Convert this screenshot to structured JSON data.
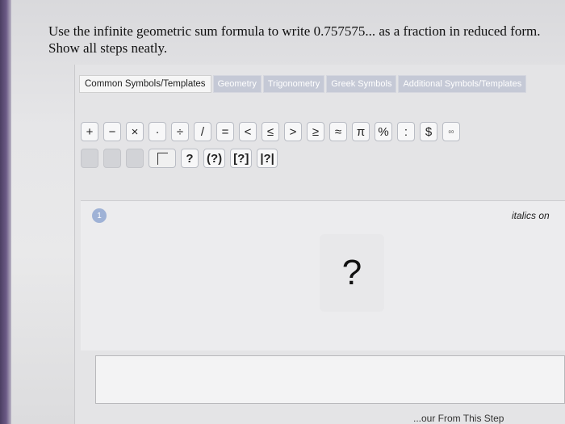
{
  "question": {
    "line1": "Use the infinite geometric sum formula to write 0.757575... as a fraction in reduced form.",
    "line2": "Show all steps neatly."
  },
  "tabs": [
    {
      "label": "Common Symbols/Templates"
    },
    {
      "label": "Geometry"
    },
    {
      "label": "Trigonometry"
    },
    {
      "label": "Greek Symbols"
    },
    {
      "label": "Additional Symbols/Templates"
    }
  ],
  "palette": {
    "row1": [
      "+",
      "−",
      "×",
      "·",
      "÷",
      "/",
      "=",
      "<",
      "≤",
      ">",
      "≥",
      "≈",
      "π",
      "%",
      ":",
      "$",
      "∞"
    ],
    "row2": [
      "?",
      "(?)",
      "[?]",
      "|?|"
    ]
  },
  "step": {
    "number": "1",
    "italics_label": "italics on",
    "answer_placeholder": "?"
  },
  "footer": {
    "link_text": "...our From This Step"
  }
}
